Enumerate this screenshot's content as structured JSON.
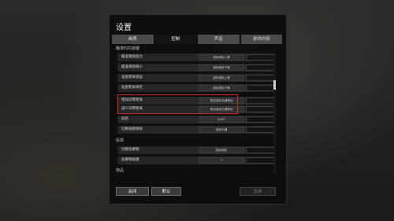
{
  "window": {
    "title": "设置"
  },
  "tabs": [
    {
      "label": "画质",
      "active": false
    },
    {
      "label": "控制",
      "active": true
    },
    {
      "label": "声音",
      "active": false
    },
    {
      "label": "游戏内容",
      "active": false
    }
  ],
  "sections": {
    "top": "瞄准时的按键",
    "second": "投掷",
    "third": "物品"
  },
  "rows": [
    {
      "label": "瞄准镜倍放大",
      "value": "鼠标滚轮上滑"
    },
    {
      "label": "瞄准镜倍缩小",
      "value": "鼠标滚轮下滑"
    },
    {
      "label": "准星距离调远",
      "value": "鼠标滚轮上滑"
    },
    {
      "label": "准星距离调近",
      "value": "鼠标滚轮下滑"
    },
    {
      "label": "增加归零距离",
      "value": "按住鼠标右键滑动"
    },
    {
      "label": "减少归零距离",
      "value": "按住鼠标左键滑动"
    },
    {
      "label": "屏息",
      "value": "SHIFT"
    },
    {
      "label": "切换肩膀视角",
      "value": "鼠标中键"
    }
  ],
  "throw_rows": [
    {
      "label": "切换投掷物",
      "value": "鼠标滚轮"
    },
    {
      "label": "投掷物按键",
      "value": "7"
    }
  ],
  "buttons": {
    "close": "关闭",
    "default": "默认",
    "apply": "应用"
  },
  "colors": {
    "highlight": "#c8282c"
  }
}
